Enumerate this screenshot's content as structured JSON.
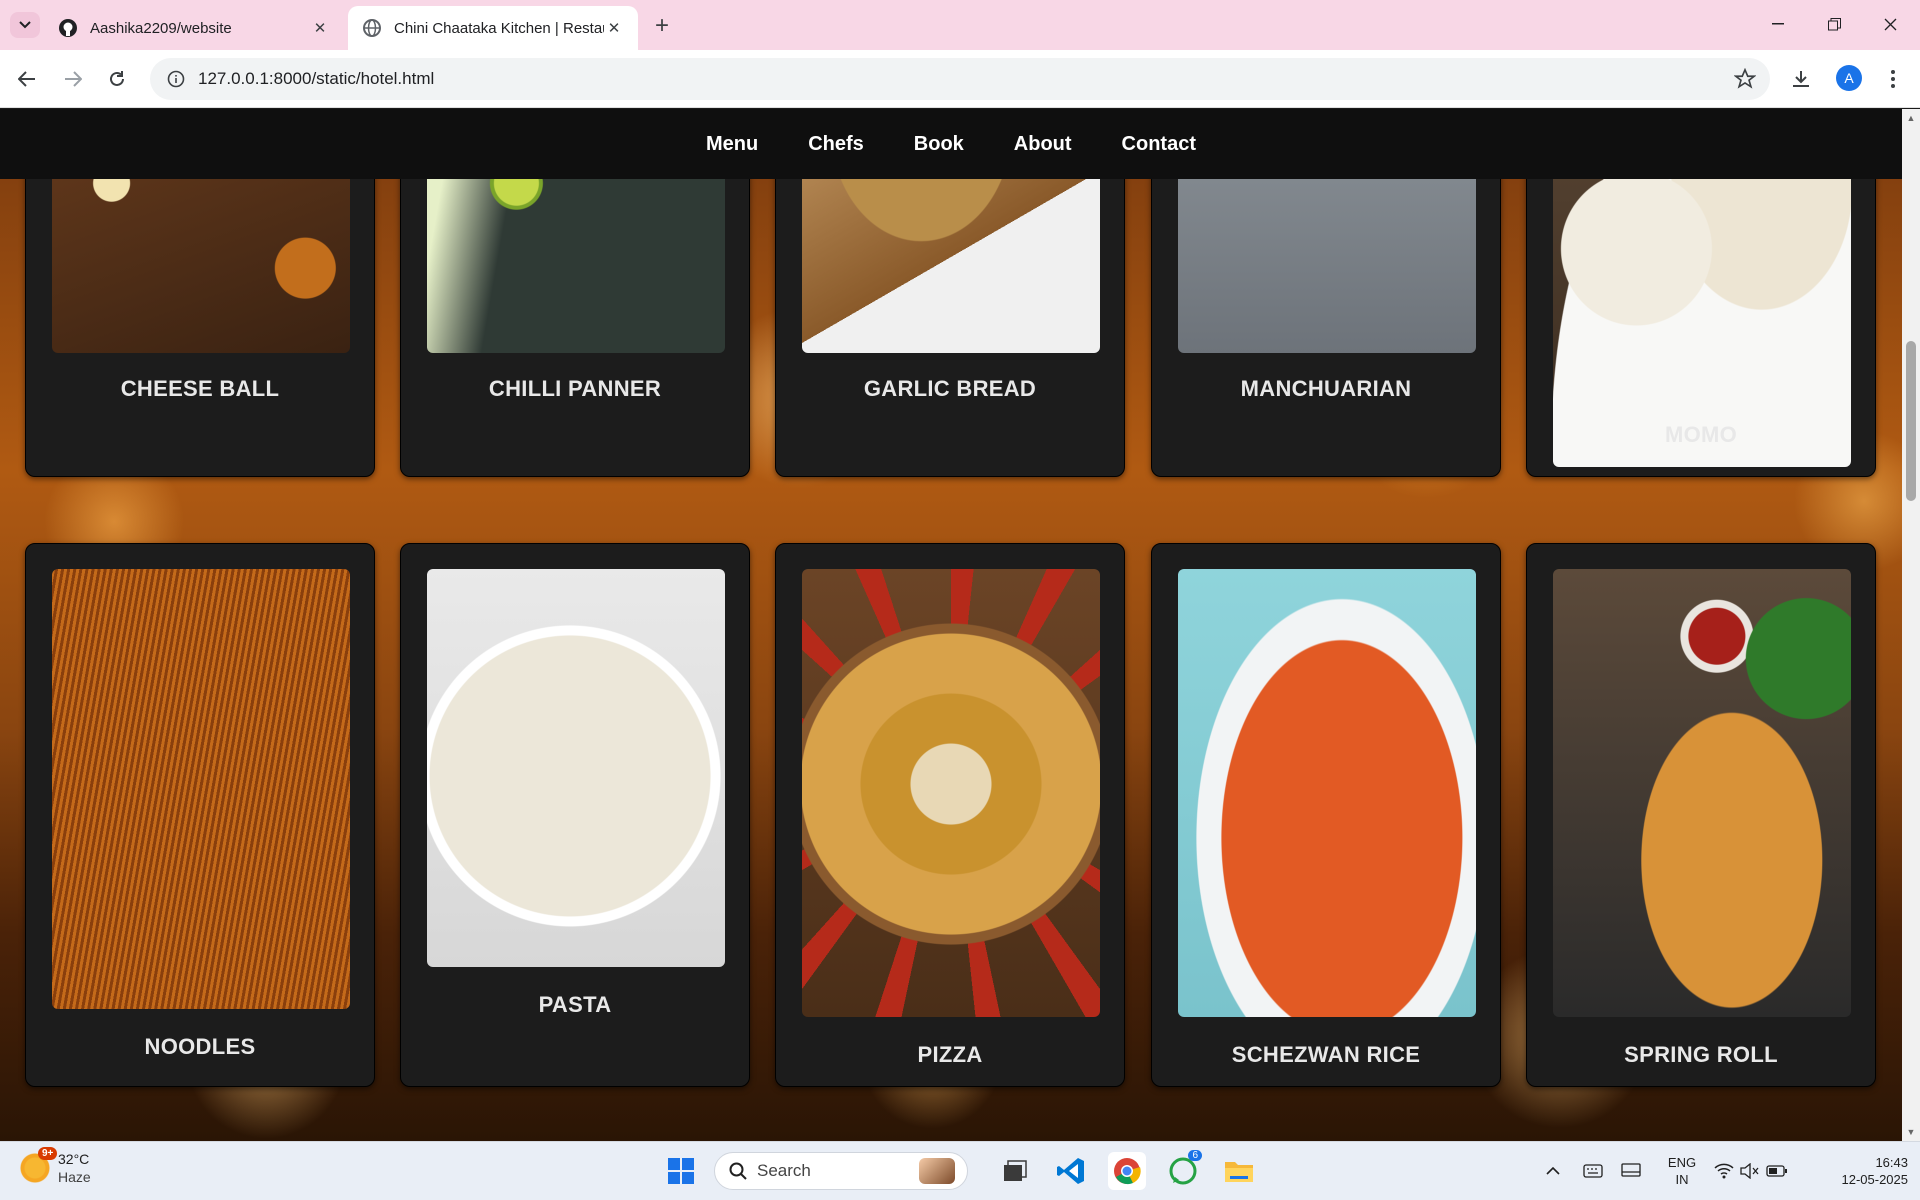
{
  "browser": {
    "tabs": [
      {
        "title": "Aashika2209/website",
        "favicon": "github-icon",
        "active": false
      },
      {
        "title": "Chini Chaataka Kitchen | Restau",
        "favicon": "globe-icon",
        "active": true
      }
    ],
    "url": "127.0.0.1:8000/static/hotel.html",
    "profile_initial": "A"
  },
  "site": {
    "nav": [
      "Menu",
      "Chefs",
      "Book",
      "About",
      "Contact"
    ],
    "dishes_row1": [
      "CHEESE BALL",
      "CHILLI PANNER",
      "GARLIC BREAD",
      "MANCHUARIAN",
      "MOMO"
    ],
    "dishes_row2": [
      "NOODLES",
      "PASTA",
      "PIZZA",
      "SCHEZWAN RICE",
      "SPRING ROLL"
    ]
  },
  "taskbar": {
    "weather_temp": "32°C",
    "weather_cond": "Haze",
    "weather_badge": "9+",
    "search_placeholder": "Search",
    "vscode_badge": "",
    "whatsapp_badge": "6",
    "lang_top": "ENG",
    "lang_bottom": "IN",
    "time": "16:43",
    "date": "12-05-2025"
  }
}
